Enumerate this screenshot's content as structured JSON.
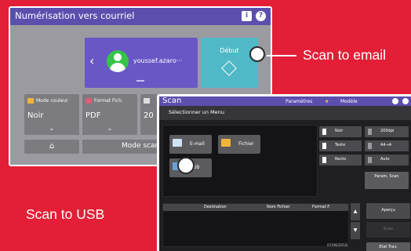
{
  "screen1": {
    "title": "Numérisation vers courriel",
    "username": "youssef.azaro···",
    "start_label": "Début",
    "settings": [
      {
        "label": "Mode couleur",
        "value": "Noir"
      },
      {
        "label": "Format Fich.",
        "value": "PDF"
      },
      {
        "label": "",
        "value": "20"
      }
    ],
    "scan_mode_label": "Mode scan"
  },
  "screen2": {
    "title": "Scan",
    "tabs": [
      "Paramètres",
      "Modèle"
    ],
    "subtitle": "Sélectionner un Menu",
    "menu": [
      "E-mail",
      "Fichier",
      "USB"
    ],
    "options": [
      "Noir",
      "200dpi",
      "Texte",
      "A4→A",
      "Recto",
      "Auto"
    ],
    "param_scan": "Param. Scan",
    "dest_headers": [
      "Destination",
      "Nom Fichier",
      "Format F."
    ],
    "apercu": "Aperçu",
    "scan_btn": "Scan",
    "datetime": "07/06/2018",
    "etat": "Etat Trav."
  },
  "callouts": {
    "email": "Scan to email",
    "usb": "Scan to USB"
  }
}
